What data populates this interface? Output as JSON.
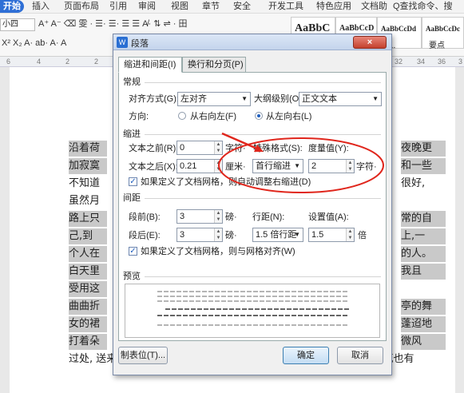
{
  "menubar": {
    "start": "开始",
    "items": [
      "插入",
      "页面布局",
      "引用",
      "审阅",
      "视图",
      "章节",
      "安全",
      "开发工具",
      "特色应用",
      "文档助"
    ],
    "search": "Q查找命令、搜"
  },
  "ribbon": {
    "font_size": "小四",
    "row1": "A⁺ A⁻ ⌫  雯 · ☰· ☰·  ☰ ☰  A̸·  ⇅  ⇌ ·  田",
    "row2": "X² X₂  A· ab·  A·  A",
    "styles": [
      {
        "label": "AaBbC",
        "sub": ""
      },
      {
        "label": "AaBbCcD",
        "sub": ""
      },
      {
        "label": "AaBbCcDd",
        "sub": "段..."
      },
      {
        "label": "AaBbCcDc",
        "sub": "要点"
      }
    ]
  },
  "ruler": {
    "ticks": [
      "6",
      "4",
      "2",
      "2",
      "32",
      "34",
      "36",
      "3"
    ]
  },
  "document": {
    "lines": [
      {
        "text": "沿着荷",
        "right": "夜晚更"
      },
      {
        "text": "加寂寞",
        "right": "和一些"
      },
      {
        "text": "不知道",
        "right": "很好,"
      },
      {
        "text": "虽然月",
        "right": ""
      },
      {
        "text": "路上只",
        "right": "常的自"
      },
      {
        "text": "己,到",
        "right": "上,一"
      },
      {
        "text": "个人在",
        "right": "的人。"
      },
      {
        "text": "白天里",
        "right": "我且"
      },
      {
        "text": "受用这",
        "right": ""
      },
      {
        "text": "曲曲折",
        "right": "亭的舞"
      },
      {
        "text": "女的裙",
        "right": "蓬迢地"
      },
      {
        "text": "打着朵",
        "right": "微风"
      },
      {
        "text": "过处, 送来缕缕清香, 仿佛远处高楼上渺茫的歌声似的。这时候叶子与花也有",
        "right": ""
      }
    ]
  },
  "dialog": {
    "title": "段落",
    "close": "×",
    "tabs": [
      "缩进和间距(I)",
      "换行和分页(P)"
    ],
    "general": {
      "section": "常规",
      "align_label": "对齐方式(G):",
      "align_value": "左对齐",
      "outline_label": "大纲级别(O):",
      "outline_value": "正文文本",
      "direction_label": "方向:",
      "rtl_label": "从右向左(F)",
      "ltr_label": "从左向右(L)"
    },
    "indent": {
      "section": "缩进",
      "before_label": "文本之前(R):",
      "before_value": "0",
      "before_unit": "字符·",
      "after_label": "文本之后(X):",
      "after_value": "0.21",
      "after_unit": "厘米·",
      "special_label": "特殊格式(S):",
      "special_value": "首行缩进",
      "measure_label": "度量值(Y):",
      "measure_value": "2",
      "measure_unit": "字符·",
      "grid_check": "如果定义了文档网格，则自动调整右缩进(D)"
    },
    "spacing": {
      "section": "间距",
      "before_label": "段前(B):",
      "before_value": "3",
      "before_unit": "磅·",
      "after_label": "段后(E):",
      "after_value": "3",
      "after_unit": "磅·",
      "line_label": "行距(N):",
      "line_value": "1.5 倍行距",
      "setting_label": "设置值(A):",
      "setting_value": "1.5",
      "setting_unit": "倍",
      "grid_check": "如果定义了文档网格，则与网格对齐(W)"
    },
    "preview": {
      "section": "预览"
    },
    "buttons": {
      "tabs": "制表位(T)...",
      "ok": "确定",
      "cancel": "取消"
    }
  },
  "colors": {
    "accent": "#2f6fd6",
    "annotation": "#e0261c",
    "selection": "#c9c9c9"
  }
}
